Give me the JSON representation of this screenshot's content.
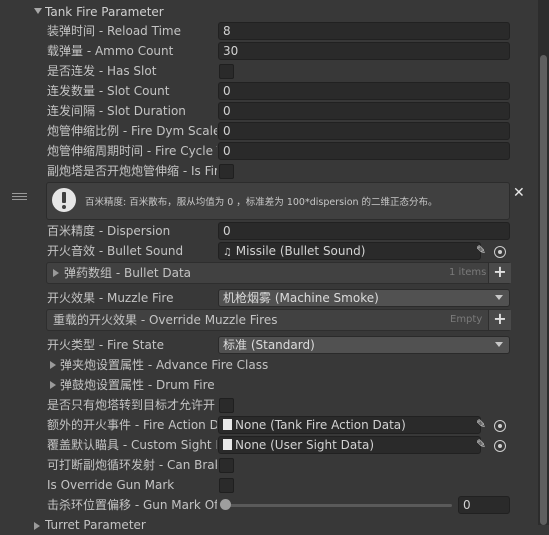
{
  "header": {
    "title": "Tank Fire Parameter",
    "bottom_title": "Turret Parameter"
  },
  "rows": {
    "reload_time": {
      "label": "装弹时间 - Reload Time",
      "value": "8"
    },
    "ammo_count": {
      "label": "载弹量 - Ammo Count",
      "value": "30"
    },
    "has_slot": {
      "label": "是否连发 - Has Slot"
    },
    "slot_count": {
      "label": "连发数量 - Slot Count",
      "value": "0"
    },
    "slot_duration": {
      "label": "连发间隔 - Slot Duration",
      "value": "0"
    },
    "fire_dym_scale": {
      "label": "炮管伸缩比例 - Fire Dym Scale",
      "value": "0"
    },
    "fire_cycle": {
      "label": "炮管伸缩周期时间 - Fire Cycle T",
      "value": "0"
    },
    "is_fire": {
      "label": "副炮塔是否开炮炮管伸缩 - Is Fir"
    },
    "help_text": "百米精度: 百米散布，服从均值为 0 ，标准差为 100*dispersion 的二维正态分布。",
    "dispersion": {
      "label": "百米精度 - Dispersion",
      "value": "0"
    },
    "bullet_sound": {
      "label": "开火音效 - Bullet Sound",
      "value": "Missile (Bullet Sound)"
    },
    "bullet_data": {
      "label": "弹药数组 - Bullet Data",
      "count": "1 items"
    },
    "muzzle_fire": {
      "label": "开火效果 - Muzzle Fire",
      "value": "机枪烟雾 (Machine Smoke)"
    },
    "override_muzzle": {
      "label": "重载的开火效果 - Override Muzzle Fires",
      "empty": "Empty"
    },
    "fire_state": {
      "label": "开火类型 - Fire State",
      "value": "标准 (Standard)"
    },
    "advance_fire": {
      "label": "弹夹炮设置属性 - Advance Fire Class"
    },
    "drum_fire": {
      "label": "弹鼓炮设置属性 - Drum Fire"
    },
    "only_turret": {
      "label": "是否只有炮塔转到目标才允许开"
    },
    "fire_action": {
      "label": "额外的开火事件 - Fire Action Da",
      "value": "None (Tank Fire Action Data)"
    },
    "custom_sight": {
      "label": "覆盖默认瞄具 - Custom Sight D",
      "value": "None (User Sight Data)"
    },
    "can_brake": {
      "label": "可打断副炮循环发射 - Can Brak"
    },
    "override_gun_mark": {
      "label": "Is Override Gun Mark"
    },
    "gun_mark_offset": {
      "label": "击杀环位置偏移 - Gun Mark Off",
      "value": "0",
      "fraction": 0
    }
  },
  "icons": [
    "chevron-down-icon",
    "drag-handle-icon",
    "warning-icon",
    "close-icon",
    "audio-clip-icon",
    "pencil-icon",
    "object-picker-icon",
    "plus-icon",
    "foldout-arrow-icon",
    "script-icon"
  ]
}
